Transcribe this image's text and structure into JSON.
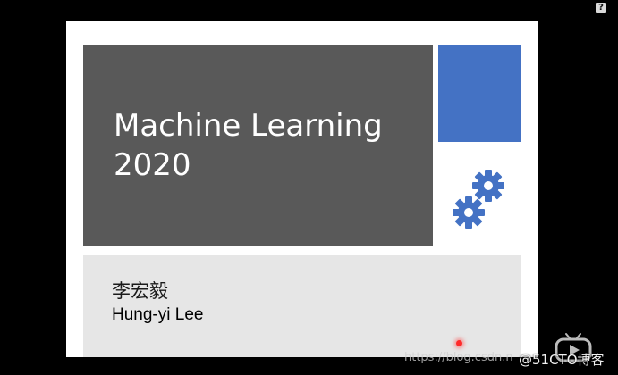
{
  "help": {
    "label": "?"
  },
  "slide": {
    "title_line1": "Machine Learning",
    "title_line2": "2020",
    "author_zh": "李宏毅",
    "author_en": "Hung-yi Lee"
  },
  "watermark": {
    "url": "https://blog.csdn.n",
    "brand": "@51CTO博客"
  },
  "icons": {
    "gears": "gears-icon",
    "tv": "tv-logo-icon"
  },
  "colors": {
    "background": "#000000",
    "slide": "#ffffff",
    "title_box": "#595959",
    "accent": "#4472c4",
    "author_box": "#e6e6e6",
    "pointer": "#ff2a2a"
  }
}
